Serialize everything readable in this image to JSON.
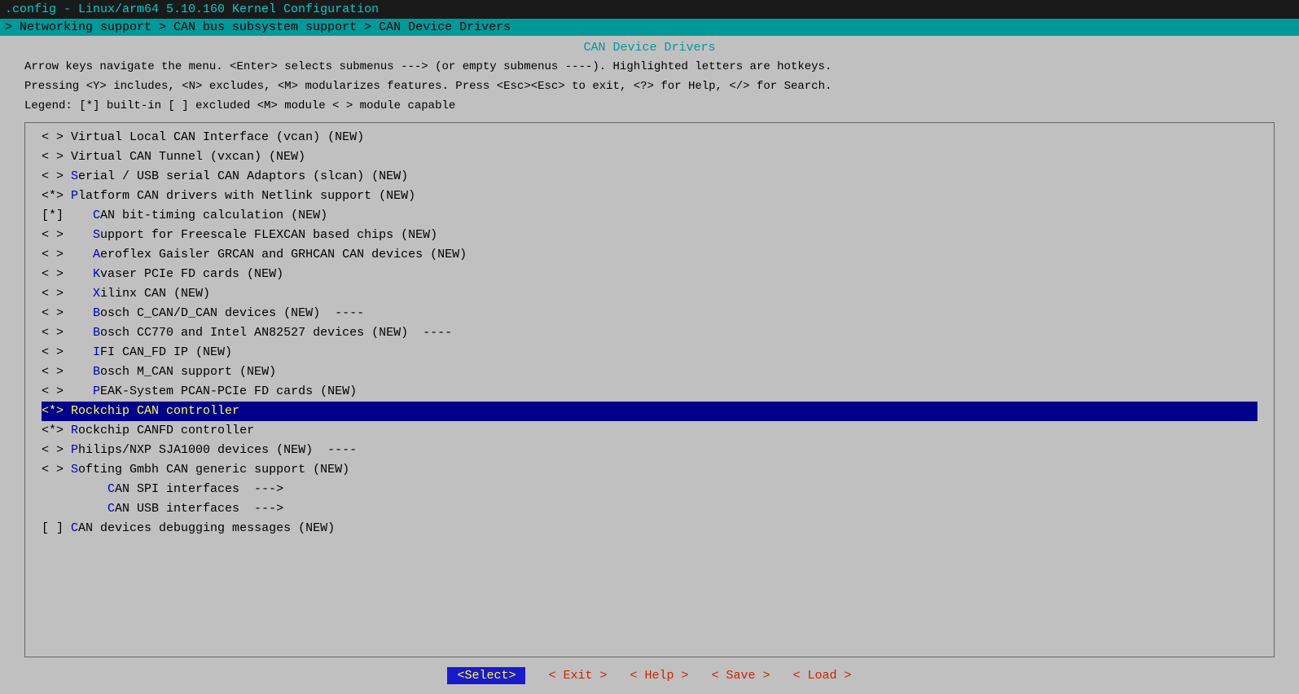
{
  "window": {
    "title": ".config - Linux/arm64 5.10.160 Kernel Configuration",
    "breadcrumb": "> Networking support > CAN bus subsystem support > CAN Device Drivers",
    "page_title": "CAN Device Drivers"
  },
  "instructions": [
    "Arrow keys navigate the menu.  <Enter> selects submenus ---> (or empty submenus ----).  Highlighted letters are hotkeys.",
    "Pressing <Y> includes, <N> excludes, <M> modularizes features.  Press <Esc><Esc> to exit, <?> for Help, </> for Search.",
    "Legend: [*] built-in  [ ] excluded  <M> module  < > module capable"
  ],
  "menu_items": [
    {
      "prefix": "< > ",
      "hotkey": "",
      "label": "Virtual Local CAN Interface (vcan) (NEW)",
      "highlighted": false
    },
    {
      "prefix": "< > ",
      "hotkey": "",
      "label": "Virtual CAN Tunnel (vxcan) (NEW)",
      "highlighted": false
    },
    {
      "prefix": "< > ",
      "hotkey": "S",
      "label": "erial / USB serial CAN Adaptors (slcan) (NEW)",
      "highlighted": false
    },
    {
      "prefix": "<*> ",
      "hotkey": "P",
      "label": "latform CAN drivers with Netlink support (NEW)",
      "highlighted": false
    },
    {
      "prefix": "[*]    ",
      "hotkey": "C",
      "label": "AN bit-timing calculation (NEW)",
      "highlighted": false
    },
    {
      "prefix": "< >    ",
      "hotkey": "S",
      "label": "upport for Freescale FLEXCAN based chips (NEW)",
      "highlighted": false
    },
    {
      "prefix": "< >    ",
      "hotkey": "A",
      "label": "eroflex Gaisler GRCAN and GRHCAN CAN devices (NEW)",
      "highlighted": false
    },
    {
      "prefix": "< >    ",
      "hotkey": "K",
      "label": "vaser PCIe FD cards (NEW)",
      "highlighted": false
    },
    {
      "prefix": "< >    ",
      "hotkey": "X",
      "label": "ilinx CAN (NEW)",
      "highlighted": false
    },
    {
      "prefix": "< >    ",
      "hotkey": "B",
      "label": "osch C_CAN/D_CAN devices (NEW)  ----",
      "highlighted": false
    },
    {
      "prefix": "< >    ",
      "hotkey": "B",
      "label": "osch CC770 and Intel AN82527 devices (NEW)  ----",
      "highlighted": false
    },
    {
      "prefix": "< >    ",
      "hotkey": "I",
      "label": "FI CAN_FD IP (NEW)",
      "highlighted": false
    },
    {
      "prefix": "< >    ",
      "hotkey": "B",
      "label": "osch M_CAN support (NEW)",
      "highlighted": false
    },
    {
      "prefix": "< >    ",
      "hotkey": "P",
      "label": "EAK-System PCAN-PCIe FD cards (NEW)",
      "highlighted": false
    },
    {
      "prefix": "<*> ",
      "hotkey": "R",
      "label": "ockchip CAN controller",
      "highlighted": true
    },
    {
      "prefix": "<*> ",
      "hotkey": "R",
      "label": "ockchip CANFD controller",
      "highlighted": false
    },
    {
      "prefix": "< > ",
      "hotkey": "P",
      "label": "hilips/NXP SJA1000 devices (NEW)  ----",
      "highlighted": false
    },
    {
      "prefix": "< > ",
      "hotkey": "S",
      "label": "ofting Gmbh CAN generic support (NEW)",
      "highlighted": false
    },
    {
      "prefix": "         ",
      "hotkey": "C",
      "label": "AN SPI interfaces  --->",
      "highlighted": false
    },
    {
      "prefix": "         ",
      "hotkey": "C",
      "label": "AN USB interfaces  --->",
      "highlighted": false
    },
    {
      "prefix": "[ ] ",
      "hotkey": "C",
      "label": "AN devices debugging messages (NEW)",
      "highlighted": false
    }
  ],
  "buttons": {
    "select": "<Select>",
    "exit": "< Exit >",
    "help": "< Help >",
    "save": "< Save >",
    "load": "< Load >"
  }
}
